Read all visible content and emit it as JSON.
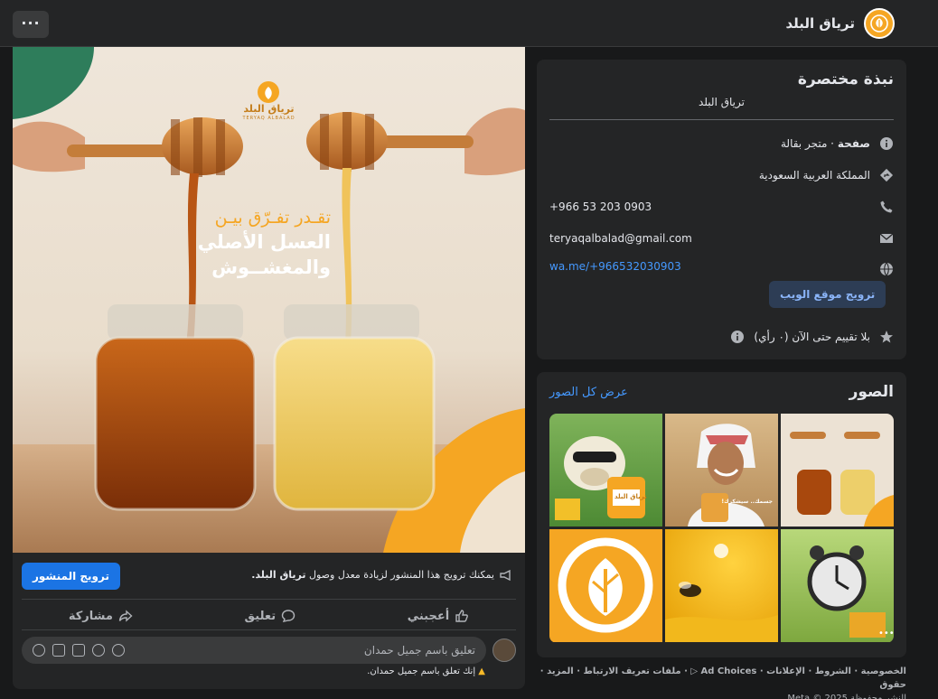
{
  "header": {
    "page_name": "ترياق البلد",
    "more_label": "···"
  },
  "post": {
    "image": {
      "brand_text": "ترياق البلد",
      "brand_sub": "TERYAQ ALBALAD",
      "headline_line1": "تقـدر تفـرّق بيـن",
      "headline_line2": "العسل الأصلي",
      "headline_line3": "والمغشــوش"
    },
    "promote_button": "ترويج المنشور",
    "promote_text_prefix": "يمكنك ترويج هذا المنشور لزيادة معدل وصول ",
    "promote_text_page": "ترياق البلد.",
    "actions": {
      "like": "أعجبني",
      "comment": "تعليق",
      "share": "مشاركة"
    },
    "comment_placeholder": "تعليق باسم جميل حمدان",
    "comment_warning": "إنك تعلق باسم جميل حمدان."
  },
  "intro": {
    "title": "نبذة مختصرة",
    "bio": "ترياق البلد",
    "category_bold": "صفحة",
    "category_rest": " · متجر بقالة",
    "location": "المملكة العربية السعودية",
    "phone": "+966 53 203 0903",
    "email": "teryaqalbalad@gmail.com",
    "website": "wa.me/+966532030903",
    "promote_website": "ترويج موقع الويب",
    "rating": "بلا تقييم حتى الآن (٠ رأي)"
  },
  "photos": {
    "title": "الصور",
    "see_all": "عرض كل الصور",
    "tile_texts": {
      "t1": "ترياق البلد",
      "t2": "جسمك.. سيشكرك!"
    }
  },
  "footer": {
    "line1": "الخصوصية · الشروط · الإعلانات · Ad Choices ▷ · ملفات تعريف الارتباط · المزيد · حقوق",
    "line2": "النشر محفوظة Meta © 2025"
  },
  "colors": {
    "accent": "#1b74e4",
    "brand": "#f5a623",
    "bg": "#18191a",
    "card": "#242526"
  }
}
